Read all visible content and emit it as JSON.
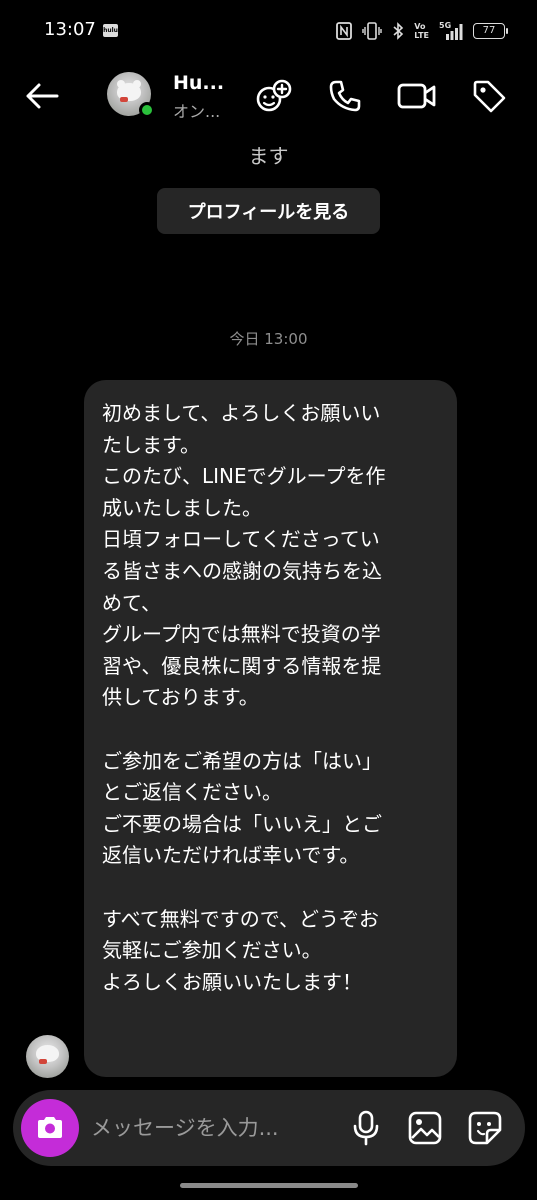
{
  "status_bar": {
    "time": "13:07",
    "app_badge": "hulu",
    "network_label_top": "Vo",
    "network_label_bottom": "LTE",
    "signal_label": "5G",
    "battery": "77"
  },
  "header": {
    "name": "Hu...",
    "status": "オン..."
  },
  "chat": {
    "top_text": "ます",
    "profile_button": "プロフィールを見る",
    "timestamp": "今日 13:00",
    "message": "初めまして、よろしくお願いい\nたします。\nこのたび、LINEでグループを作\n成いたしました。\n日頃フォローしてくださってい\nる皆さまへの感謝の気持ちを込\nめて、\nグループ内では無料で投資の学\n習や、優良株に関する情報を提\n供しております。\n\nご参加をご希望の方は「はい」\nとご返信ください。\nご不要の場合は「いいえ」とご\n返信いただければ幸いです。\n\nすべて無料ですので、どうぞお\n気軽にご参加ください。\nよろしくお願いいたします！"
  },
  "composer": {
    "placeholder": "メッセージを入力..."
  },
  "icons": {
    "back": "arrow-left-icon",
    "add_people": "add-people-icon",
    "call": "phone-icon",
    "video": "video-camera-icon",
    "tag": "tag-icon",
    "camera": "camera-icon",
    "mic": "microphone-icon",
    "gallery": "image-icon",
    "sticker": "sticker-icon"
  },
  "colors": {
    "background": "#000000",
    "bubble": "#262626",
    "camera_button": "#c42cd8",
    "online": "#2bc13c"
  }
}
